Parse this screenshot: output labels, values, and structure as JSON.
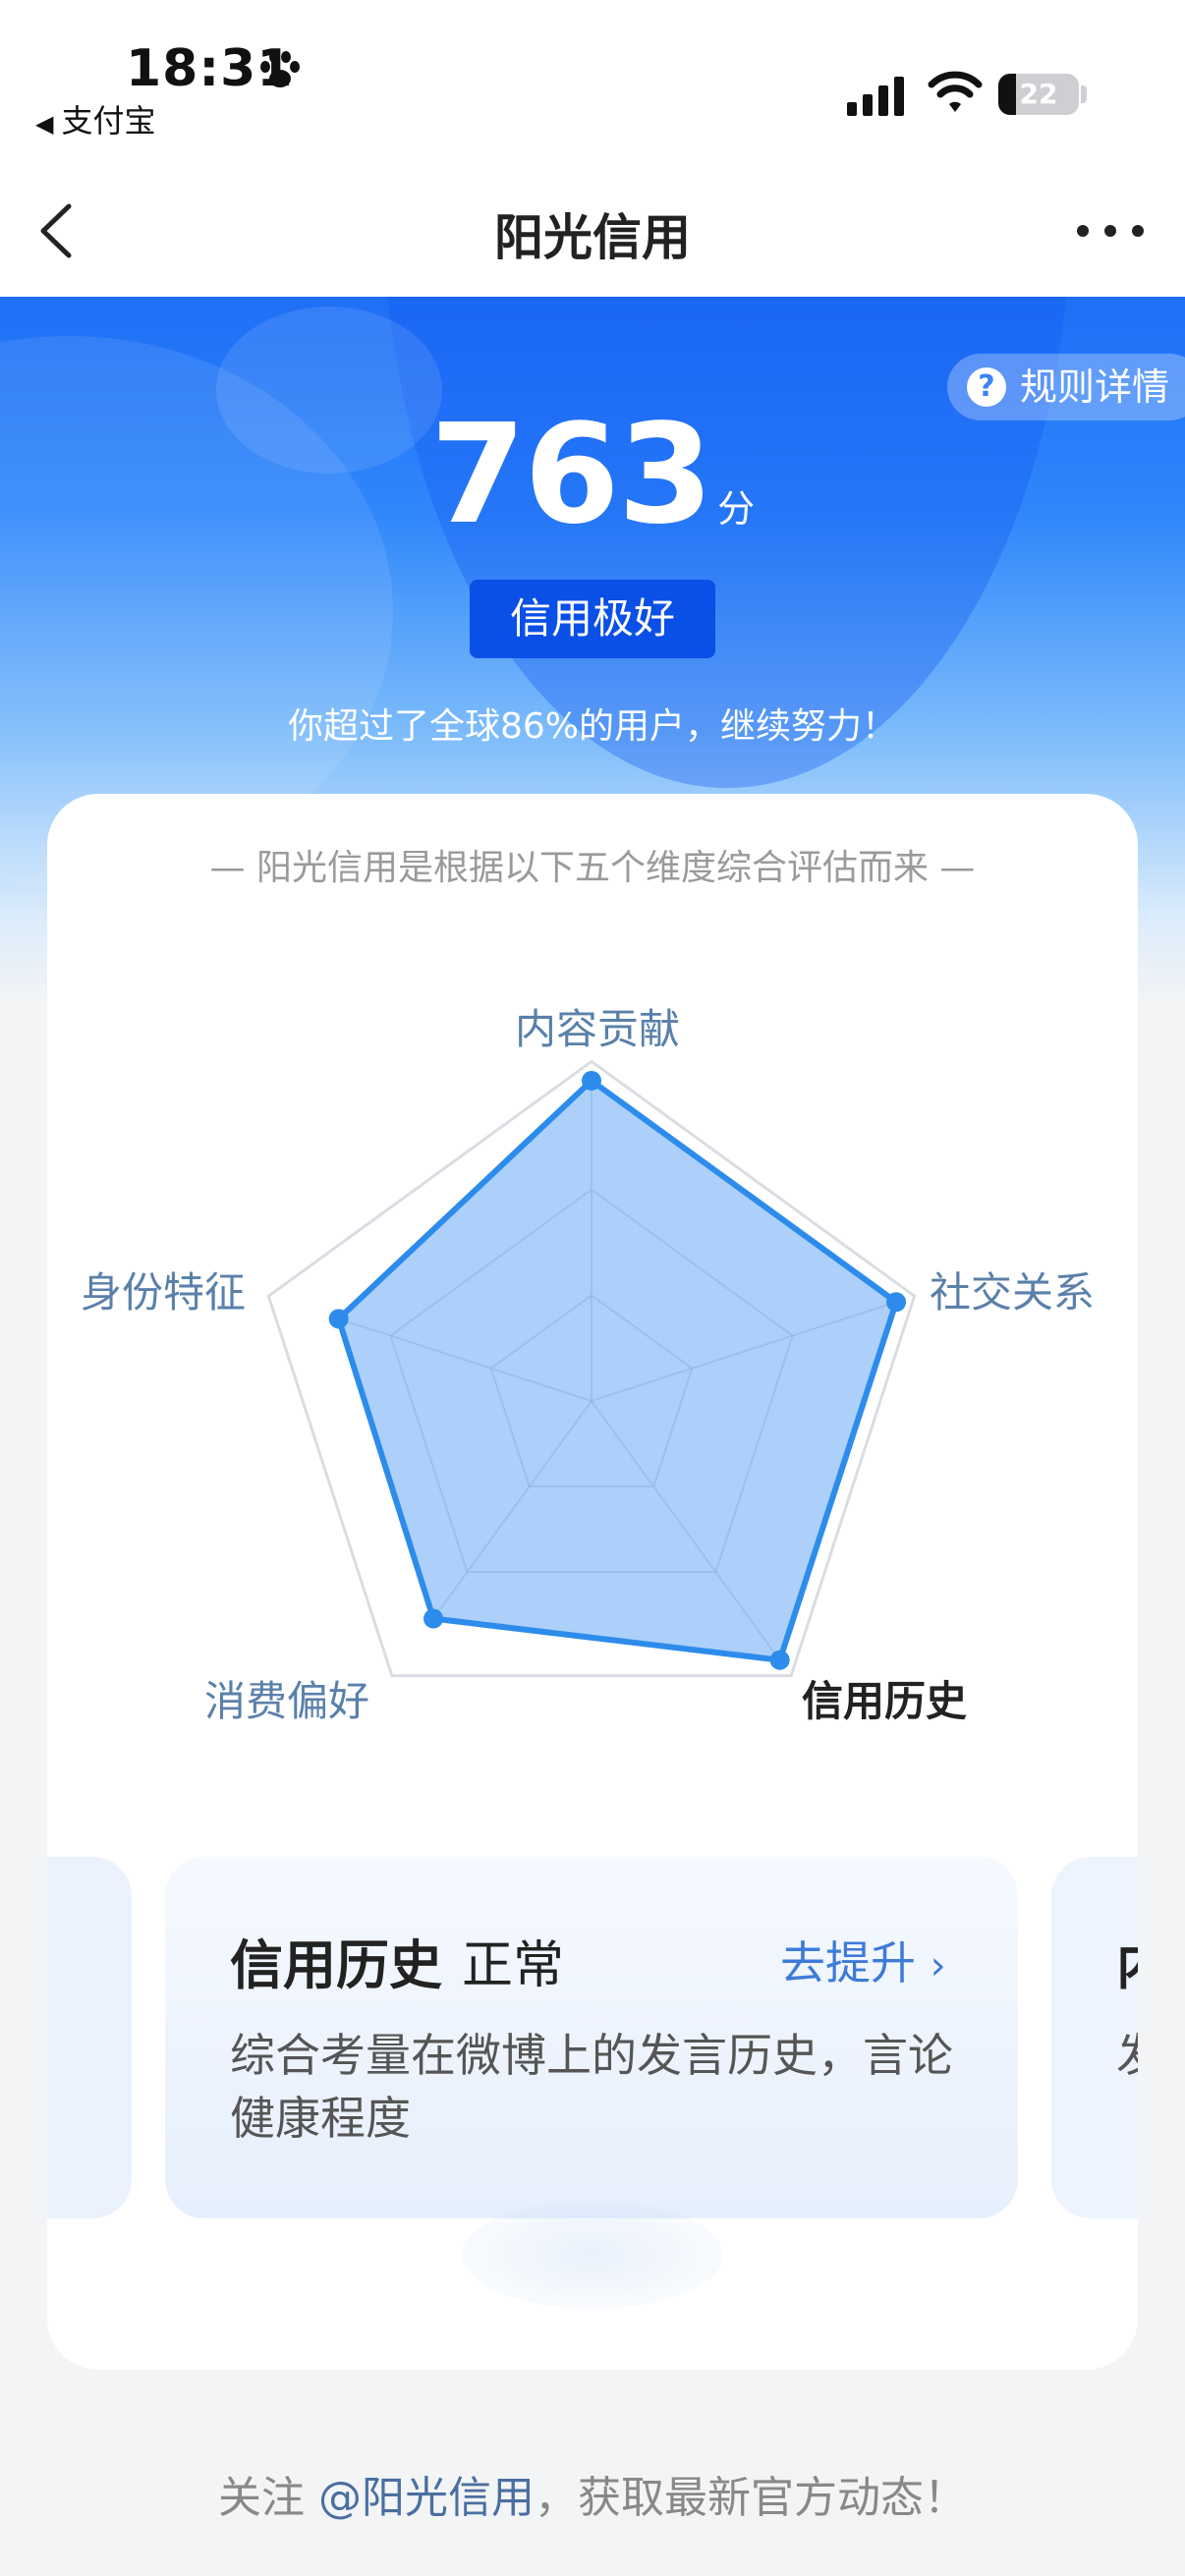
{
  "status_bar": {
    "time": "18:31",
    "back_app": "支付宝",
    "battery": "22"
  },
  "nav": {
    "title": "阳光信用",
    "back_icon": "chevron-left-icon",
    "more_icon": "more-horizontal-icon"
  },
  "hero": {
    "rules_label": "规则详情",
    "score": "763",
    "score_unit": "分",
    "level": "信用极好",
    "beat_text": "你超过了全球86%的用户，继续努力！"
  },
  "card": {
    "subtitle": "— 阳光信用是根据以下五个维度综合评估而来 —"
  },
  "radar": {
    "axes": [
      {
        "label": "内容贡献",
        "value": 1.0,
        "active": false
      },
      {
        "label": "社交关系",
        "value": 1.0,
        "active": false
      },
      {
        "label": "信用历史",
        "value": 1.0,
        "active": true
      },
      {
        "label": "消费偏好",
        "value": 0.84,
        "active": false
      },
      {
        "label": "身份特征",
        "value": 0.83,
        "active": false
      }
    ],
    "colors": {
      "fill": "#a8cef9",
      "stroke": "#2d8ceb",
      "grid": "#d9dde3"
    }
  },
  "dimension_card": {
    "title": "信用历史",
    "status": "正常",
    "link": "去提升",
    "desc": "综合考量在微博上的发言历史，言论健康程度"
  },
  "next_card_peek": {
    "title": "内容贡献",
    "desc": "发"
  },
  "footer": {
    "prefix": "关注 ",
    "mention": "@阳光信用",
    "suffix": "，获取最新官方动态！"
  }
}
